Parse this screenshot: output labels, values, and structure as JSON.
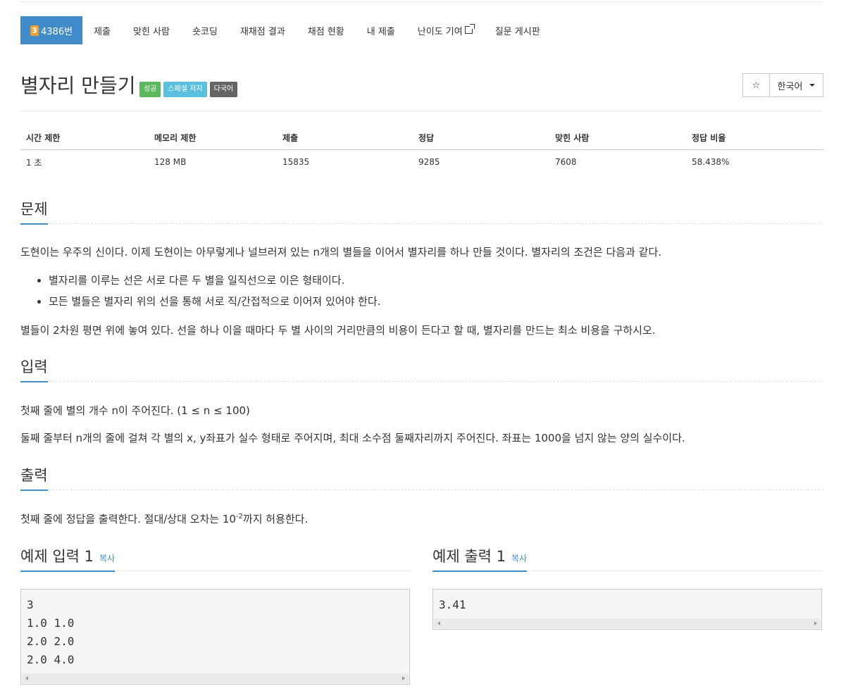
{
  "tabs": [
    {
      "tier": "3",
      "label": "4386번"
    },
    {
      "label": "제출"
    },
    {
      "label": "맞힌 사람"
    },
    {
      "label": "숏코딩"
    },
    {
      "label": "재채점 결과"
    },
    {
      "label": "채점 현황"
    },
    {
      "label": "내 제출"
    },
    {
      "label": "난이도 기여"
    },
    {
      "label": "질문 게시판"
    }
  ],
  "problem": {
    "title": "별자리 만들기",
    "labels": [
      "성공",
      "스페셜 저지",
      "다국어"
    ],
    "star": "☆",
    "language": "한국어"
  },
  "info_table": {
    "headers": [
      "시간 제한",
      "메모리 제한",
      "제출",
      "정답",
      "맞힌 사람",
      "정답 비율"
    ],
    "values": [
      "1 초",
      "128 MB",
      "15835",
      "9285",
      "7608",
      "58.438%"
    ]
  },
  "sections": {
    "problem": {
      "heading": "문제",
      "p1": "도현이는 우주의 신이다. 이제 도현이는 아무렇게나 널브러져 있는 n개의 별들을 이어서 별자리를 하나 만들 것이다. 별자리의 조건은 다음과 같다.",
      "bullets": [
        "별자리를 이루는 선은 서로 다른 두 별을 일직선으로 이은 형태이다.",
        "모든 별들은 별자리 위의 선을 통해 서로 직/간접적으로 이어져 있어야 한다."
      ],
      "p2": "별들이 2차원 평면 위에 놓여 있다. 선을 하나 이을 때마다 두 별 사이의 거리만큼의 비용이 든다고 할 때, 별자리를 만드는 최소 비용을 구하시오."
    },
    "input": {
      "heading": "입력",
      "p1": "첫째 줄에 별의 개수 n이 주어진다. (1 ≤ n ≤ 100)",
      "p2": "둘째 줄부터 n개의 줄에 걸쳐 각 별의 x, y좌표가 실수 형태로 주어지며, 최대 소수점 둘째자리까지 주어진다. 좌표는 1000을 넘지 않는 양의 실수이다."
    },
    "output": {
      "heading": "출력",
      "p1_before": "첫째 줄에 정답을 출력한다. 절대/상대 오차는 10",
      "p1_sup": "-2",
      "p1_after": "까지 허용한다."
    }
  },
  "samples": {
    "input": {
      "heading": "예제 입력 1",
      "copy": "복사",
      "lines": [
        "3",
        "1.0 1.0",
        "2.0 2.0",
        "2.0 4.0"
      ]
    },
    "output": {
      "heading": "예제 출력 1",
      "copy": "복사",
      "lines": [
        "3.41"
      ]
    }
  },
  "colors": {
    "primary": "#428bca",
    "success": "#5cb85c",
    "info": "#5bc0de",
    "default": "#666666",
    "tier": "#f0a030"
  }
}
